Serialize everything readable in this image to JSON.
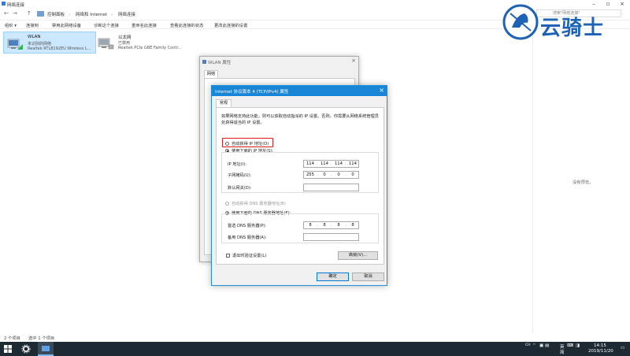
{
  "window": {
    "title": "网络连接"
  },
  "nav": {
    "back": "←",
    "forward": "→",
    "up": "↑"
  },
  "breadcrumb": [
    "控制面板",
    "网络和 Internet",
    "网络连接"
  ],
  "search": {
    "placeholder": "搜索\"网络连接\""
  },
  "toolbar": [
    "组织 ▾",
    "连接到",
    "禁用此网络设备",
    "诊断这个连接",
    "重命名此连接",
    "查看此连接的状态",
    "更改此连接的设置"
  ],
  "adapters": [
    {
      "name": "WLAN",
      "status": "未识别的网络",
      "device": "Realtek RTL8192EU Wireless L..."
    },
    {
      "name": "以太网",
      "status": "已禁用",
      "device": "Realtek PCIe GBE Family Contr..."
    }
  ],
  "preview_text": "没有预览。",
  "status_bar": {
    "count": "2 个项目",
    "selected": "选中 1 个项目"
  },
  "wlan_props": {
    "title": "WLAN 属性",
    "tab": "网络"
  },
  "ipv4": {
    "title": "Internet 协议版本 4 (TCP/IPv4) 属性",
    "close": "×",
    "tab": "常规",
    "description": "如果网络支持此功能，则可以获取自动指派的 IP 设置。否则，你需要从网络系统管理员处获得适当的 IP 设置。",
    "auto_ip": "自动获得 IP 地址(O)",
    "manual_ip": "使用下面的 IP 地址(S):",
    "ip_label": "IP 地址(I):",
    "ip_value": [
      "114",
      "114",
      "114",
      "114"
    ],
    "mask_label": "子网掩码(U):",
    "mask_value": [
      "255",
      "0",
      "0",
      "0"
    ],
    "gateway_label": "默认网关(D):",
    "gateway_value": [
      "",
      "",
      "",
      ""
    ],
    "auto_dns": "自动获得 DNS 服务器地址(B)",
    "manual_dns": "使用下面的 DNS 服务器地址(E):",
    "dns1_label": "首选 DNS 服务器(P):",
    "dns1_value": [
      "8",
      "8",
      "8",
      "8"
    ],
    "dns2_label": "备用 DNS 服务器(A):",
    "dns2_value": [
      "",
      "",
      "",
      ""
    ],
    "validate_label": "退出时验证设置(L)",
    "advanced_btn": "高级(V)...",
    "ok_btn": "确定",
    "cancel_btn": "取消"
  },
  "watermark": {
    "text": "云骑士"
  },
  "taskbar": {
    "ime1": "英",
    "ime2": "简",
    "time": "14:15",
    "date": "2019/11/20",
    "ch": "CH"
  }
}
